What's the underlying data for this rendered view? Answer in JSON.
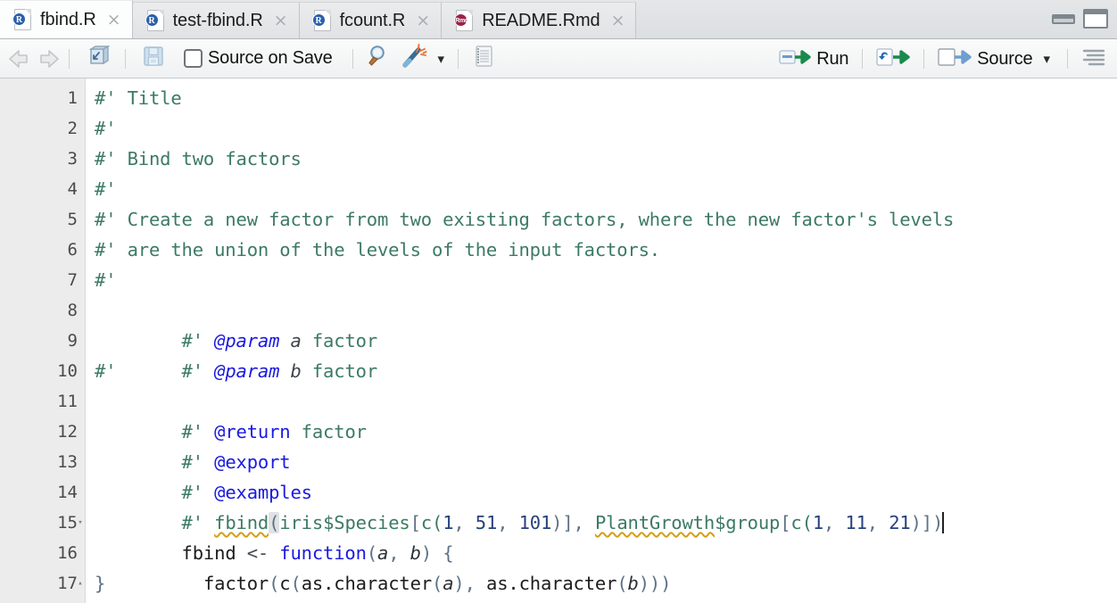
{
  "window": {
    "minimize_icon": "minimize-pane-icon",
    "maximize_icon": "maximize-pane-icon"
  },
  "tabs": [
    {
      "label": "fbind.R",
      "icon": "r-file-icon",
      "badge": "R",
      "active": true,
      "close": "×"
    },
    {
      "label": "test-fbind.R",
      "icon": "r-file-icon",
      "badge": "R",
      "active": false,
      "close": "×"
    },
    {
      "label": "fcount.R",
      "icon": "r-file-icon",
      "badge": "R",
      "active": false,
      "close": "×"
    },
    {
      "label": "README.Rmd",
      "icon": "rmd-file-icon",
      "badge": "Rmd",
      "active": false,
      "close": "×"
    }
  ],
  "toolbar": {
    "back_icon": "back-arrow-icon",
    "forward_icon": "forward-arrow-icon",
    "popout_icon": "show-in-new-window-icon",
    "save_icon": "save-icon",
    "source_on_save_label": "Source on Save",
    "source_on_save_checked": false,
    "find_icon": "find-replace-magnifier-icon",
    "magic_icon": "code-tools-magic-wand-icon",
    "magic_caret": "▾",
    "compile_report_icon": "compile-report-notebook-icon",
    "run_label": "Run",
    "run_icon": "run-line-icon",
    "rerun_icon": "re-run-previous-icon",
    "source_label": "Source",
    "source_icon": "source-document-icon",
    "source_caret": "▾",
    "outline_icon": "document-outline-icon"
  },
  "editor": {
    "lines": [
      {
        "n": "1",
        "fold": ""
      },
      {
        "n": "2",
        "fold": ""
      },
      {
        "n": "3",
        "fold": ""
      },
      {
        "n": "4",
        "fold": ""
      },
      {
        "n": "5",
        "fold": ""
      },
      {
        "n": "6",
        "fold": ""
      },
      {
        "n": "7",
        "fold": ""
      },
      {
        "n": "8",
        "fold": ""
      },
      {
        "n": "9",
        "fold": ""
      },
      {
        "n": "10",
        "fold": ""
      },
      {
        "n": "11",
        "fold": ""
      },
      {
        "n": "12",
        "fold": ""
      },
      {
        "n": "13",
        "fold": ""
      },
      {
        "n": "14",
        "fold": ""
      },
      {
        "n": "15",
        "fold": "▾"
      },
      {
        "n": "16",
        "fold": ""
      },
      {
        "n": "17",
        "fold": "▴"
      }
    ],
    "text": {
      "l1": "#' Title",
      "l2": "#'",
      "l3": "#' Bind two factors",
      "l4": "#'",
      "l5": "#' Create a new factor from two existing factors, where the new factor's levels",
      "l6": "#' are the union of the levels of the input factors.",
      "l7": "#'",
      "l8_prefix": "#' ",
      "l8_tag": "@param",
      "l8_var": " a",
      "l8_rest": " factor",
      "l9_prefix": "#' ",
      "l9_tag": "@param",
      "l9_var": " b",
      "l9_rest": " factor",
      "l10": "#'",
      "l11_prefix": "#' ",
      "l11_tag": "@return",
      "l11_rest": " factor",
      "l12_prefix": "#' ",
      "l12_tag": "@export",
      "l13_prefix": "#' ",
      "l13_tag": "@examples",
      "l14_prefix": "#' ",
      "l14_fn": "fbind",
      "l14_paren": "(",
      "l14_a": "iris$Species",
      "l14_b": "[",
      "l14_c": "c(",
      "l14_n1": "1",
      "l14_sep1": ", ",
      "l14_n2": "51",
      "l14_sep2": ", ",
      "l14_n3": "101",
      "l14_close1": ")],",
      "l14_space": " ",
      "l14_pg": "PlantGrowth",
      "l14_pg2": "$group",
      "l14_d": "[",
      "l14_e": "c(",
      "l14_n4": "1",
      "l14_sep3": ", ",
      "l14_n5": "11",
      "l14_sep4": ", ",
      "l14_n6": "21",
      "l14_close2": ")])",
      "l15_a": "fbind ",
      "l15_op": "<- ",
      "l15_kw": "function",
      "l15_p1": "(",
      "l15_v1": "a",
      "l15_c1": ", ",
      "l15_v2": "b",
      "l15_p2": ")",
      "l15_brace": " {",
      "l16_indent": "  ",
      "l16_f1": "factor",
      "l16_p1": "(",
      "l16_f2": "c",
      "l16_p2": "(",
      "l16_f3": "as.character",
      "l16_p3": "(",
      "l16_v1": "a",
      "l16_p4": ")",
      "l16_c1": ", ",
      "l16_f4": "as.character",
      "l16_p5": "(",
      "l16_v2": "b",
      "l16_p6": ")))",
      "l17": "}"
    },
    "colors": {
      "comment": "#3c7a63",
      "roxygen_tag": "#1a1ae0",
      "keyword": "#1a1ae0",
      "number": "#27417c",
      "bracket": "#5e7287",
      "text": "#1c1c1c",
      "gutter_bg": "#ececec",
      "editor_bg": "#ffffff",
      "spellcheck_squiggle": "#d4a017"
    }
  }
}
